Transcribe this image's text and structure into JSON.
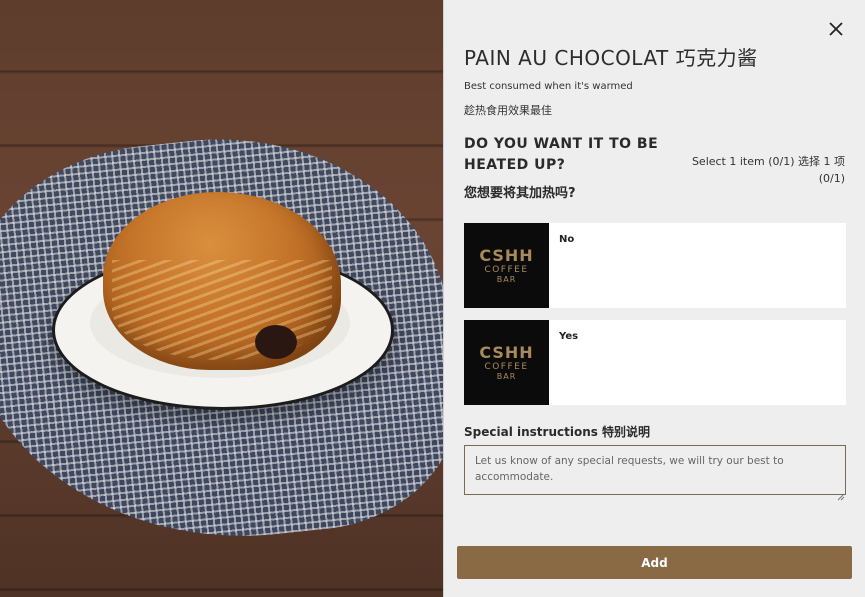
{
  "product": {
    "image_alt": "Pain au chocolat on a white plate",
    "title": "PAIN AU CHOCOLAT 巧克力酱",
    "description_en": "Best consumed when it's warmed",
    "description_cn": "趁热食用效果最佳"
  },
  "close_icon": "close-icon",
  "question": {
    "title_en": "DO YOU WANT IT TO BE HEATED UP?",
    "title_cn": "您想要将其加热吗?",
    "select_hint": "Select 1 item (0/1) 选择 1 项 (0/1)"
  },
  "options": [
    {
      "label": "No",
      "logo": {
        "line1": "CSHH",
        "line2": "COFFEE",
        "line3": "BAR"
      }
    },
    {
      "label": "Yes",
      "logo": {
        "line1": "CSHH",
        "line2": "COFFEE",
        "line3": "BAR"
      }
    }
  ],
  "special_instructions": {
    "label": "Special instructions 特别说明",
    "placeholder": "Let us know of any special requests, we will try our best to accommodate.",
    "value": ""
  },
  "add_button": {
    "label": "Add",
    "color": "#8a6a45"
  },
  "colors": {
    "panel_bg": "#eeeeee",
    "accent": "#8a6a45",
    "logo_gold": "#a98a5a"
  }
}
